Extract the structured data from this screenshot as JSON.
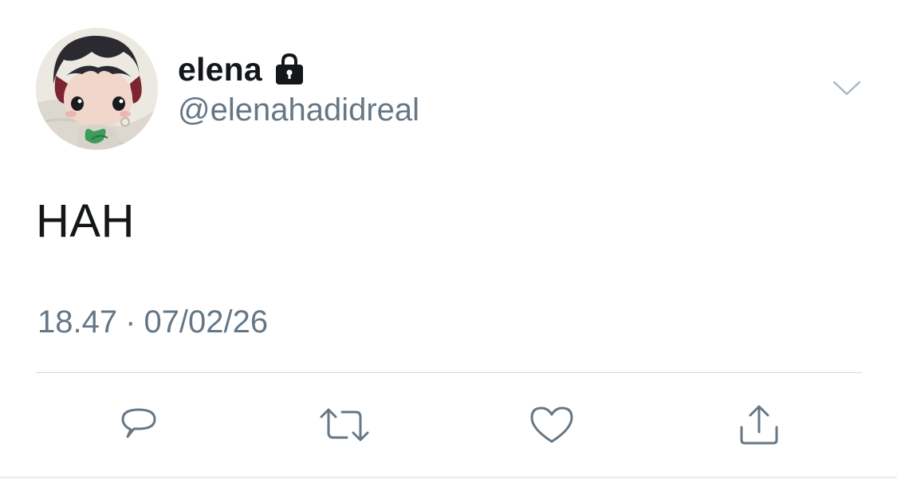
{
  "user": {
    "display_name": "elena",
    "handle": "@elenahadidreal",
    "protected": true,
    "avatar": "figurine-photo"
  },
  "tweet": {
    "text": "HAH",
    "time": "18.47",
    "separator": "·",
    "date": "07/02/26"
  },
  "icons": {
    "lock": "lock-icon",
    "menu": "chevron-down-icon",
    "reply": "reply-icon",
    "retweet": "retweet-icon",
    "like": "heart-icon",
    "share": "share-icon"
  },
  "colors": {
    "text": "#14171a",
    "secondary": "#657786",
    "divider": "#d6dbdf",
    "icon": "#657786"
  }
}
